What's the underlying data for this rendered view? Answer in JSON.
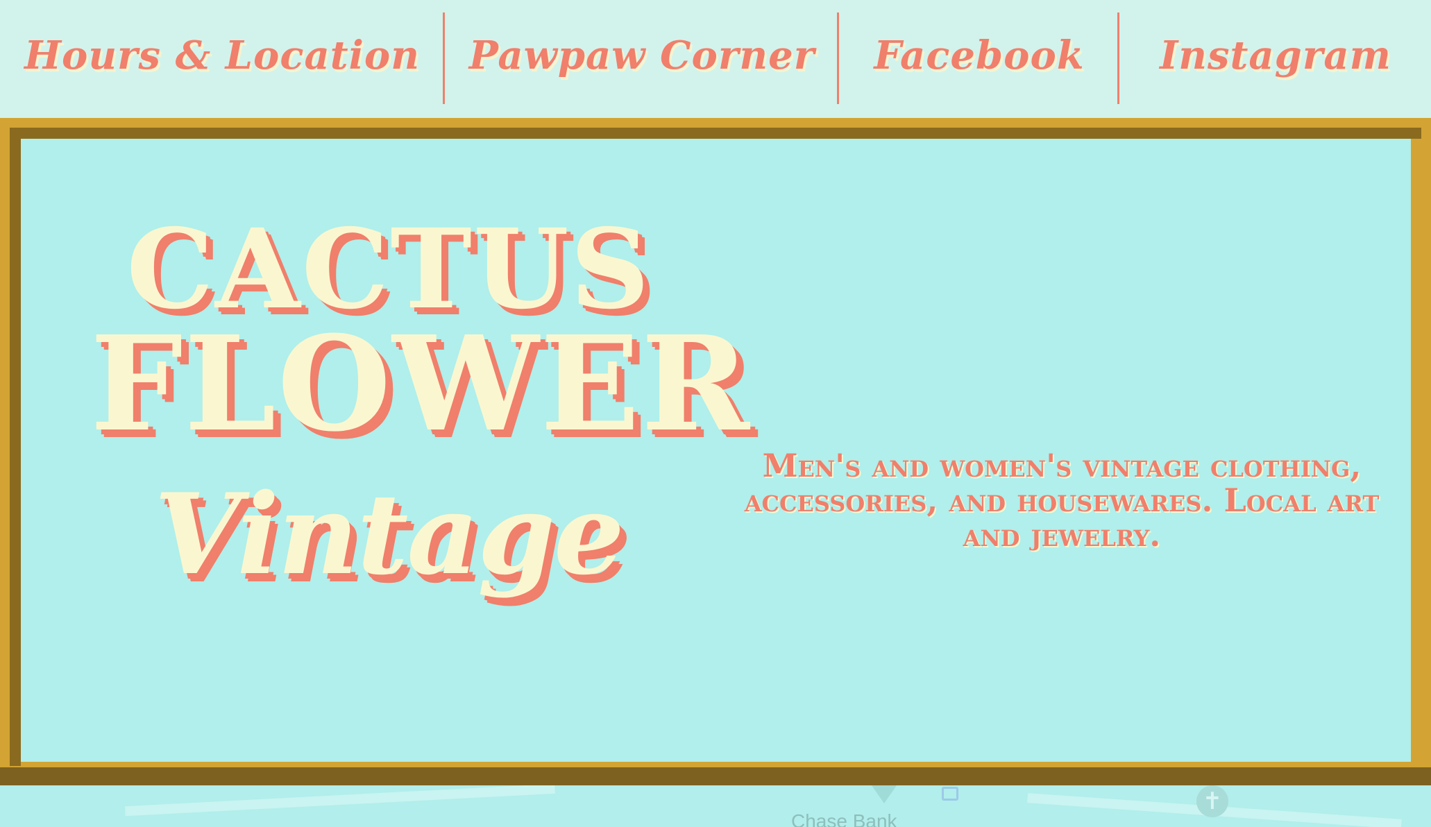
{
  "nav": {
    "items": [
      {
        "label": "Hours & Location"
      },
      {
        "label": "Pawpaw Corner"
      },
      {
        "label": "Facebook"
      },
      {
        "label": "Instagram"
      }
    ]
  },
  "hero": {
    "logo": {
      "line1": "CACTUS",
      "line2": "FLOWER",
      "line3": "Vintage"
    },
    "tagline": "Men's and women's vintage clothing, accessories,  and housewares.  Local art and jewelry."
  },
  "map": {
    "label": "Chase Bank",
    "icons": [
      "map-pin-icon",
      "bank-icon",
      "church-icon"
    ]
  },
  "colors": {
    "background": "#d2f3ec",
    "accent": "#f07f6b",
    "cream": "#faf7d0",
    "frame": "#d3a433",
    "panel": "#b0efeb"
  }
}
